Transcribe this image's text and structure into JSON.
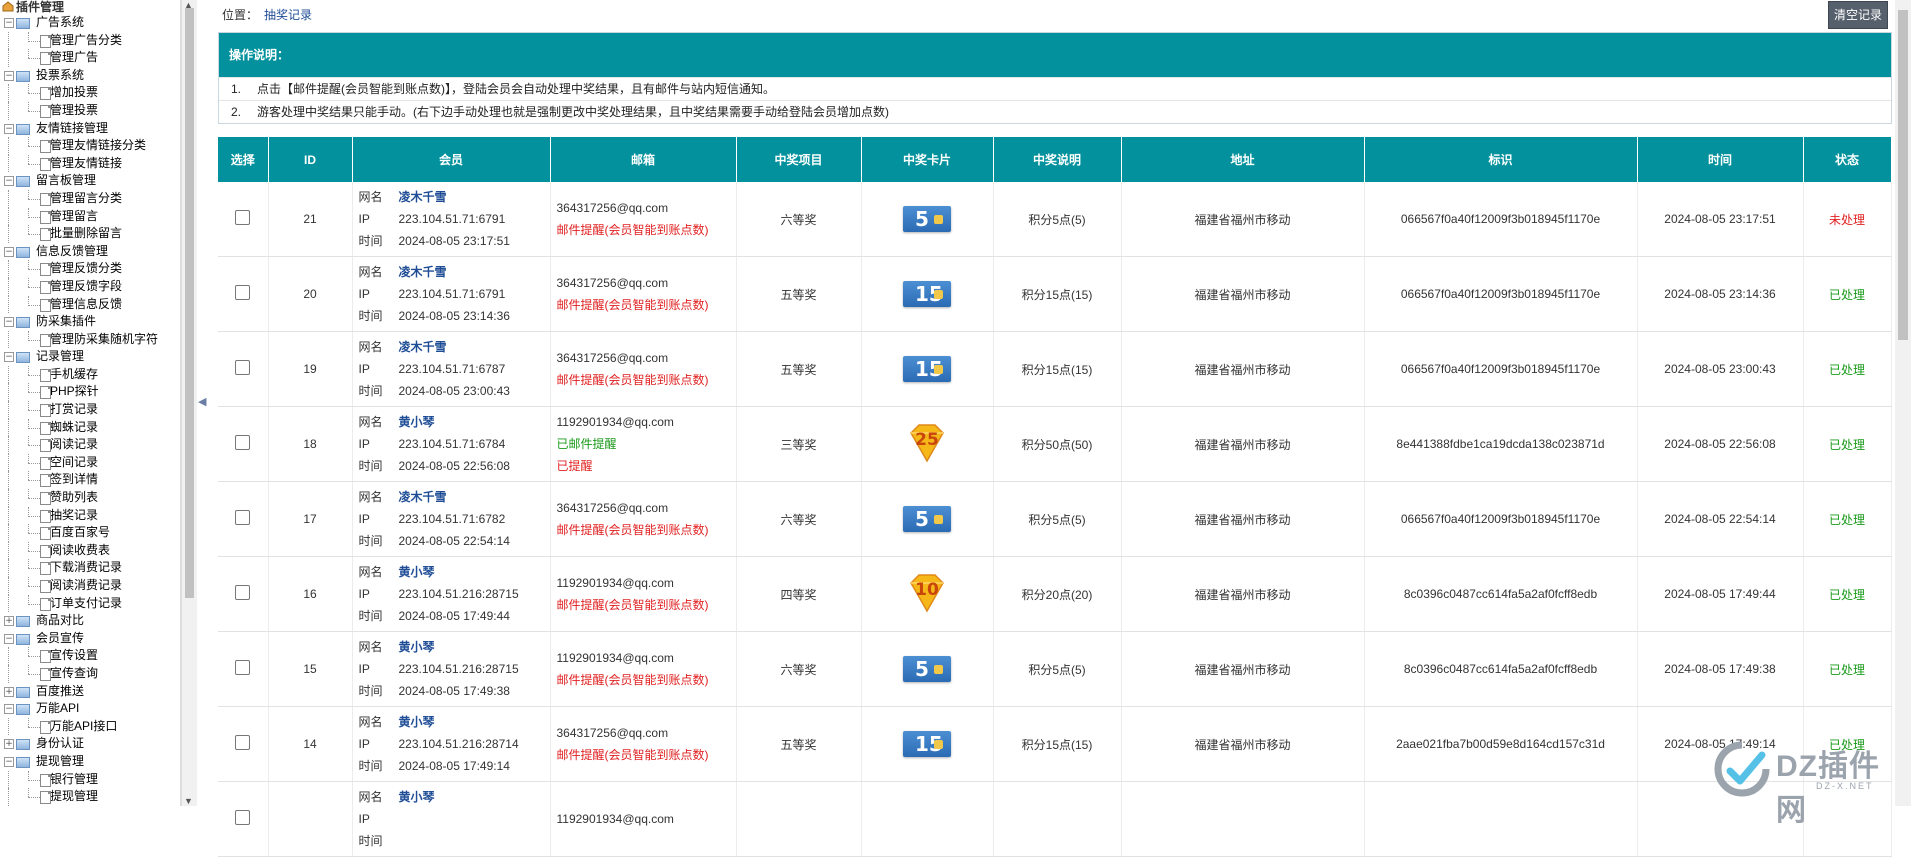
{
  "tree": {
    "root_label": "插件管理",
    "nodes": [
      {
        "kind": "cat",
        "label": "广告系统"
      },
      {
        "kind": "leaf",
        "label": "管理广告分类"
      },
      {
        "kind": "leaf",
        "label": "管理广告"
      },
      {
        "kind": "cat",
        "label": "投票系统"
      },
      {
        "kind": "leaf",
        "label": "增加投票"
      },
      {
        "kind": "leaf",
        "label": "管理投票"
      },
      {
        "kind": "cat",
        "label": "友情链接管理"
      },
      {
        "kind": "leaf",
        "label": "管理友情链接分类"
      },
      {
        "kind": "leaf",
        "label": "管理友情链接"
      },
      {
        "kind": "cat",
        "label": "留言板管理"
      },
      {
        "kind": "leaf",
        "label": "管理留言分类"
      },
      {
        "kind": "leaf",
        "label": "管理留言"
      },
      {
        "kind": "leaf",
        "label": "批量删除留言"
      },
      {
        "kind": "cat",
        "label": "信息反馈管理"
      },
      {
        "kind": "leaf",
        "label": "管理反馈分类"
      },
      {
        "kind": "leaf",
        "label": "管理反馈字段"
      },
      {
        "kind": "leaf",
        "label": "管理信息反馈"
      },
      {
        "kind": "cat",
        "label": "防采集插件"
      },
      {
        "kind": "leaf",
        "label": "管理防采集随机字符"
      },
      {
        "kind": "cat",
        "label": "记录管理"
      },
      {
        "kind": "leaf",
        "label": "手机缓存"
      },
      {
        "kind": "leaf",
        "label": "PHP探针"
      },
      {
        "kind": "leaf",
        "label": "打赏记录"
      },
      {
        "kind": "leaf",
        "label": "蜘蛛记录"
      },
      {
        "kind": "leaf",
        "label": "阅读记录"
      },
      {
        "kind": "leaf",
        "label": "空间记录"
      },
      {
        "kind": "leaf",
        "label": "签到详情"
      },
      {
        "kind": "leaf",
        "label": "赞助列表"
      },
      {
        "kind": "leaf",
        "label": "抽奖记录"
      },
      {
        "kind": "leaf",
        "label": "百度百家号"
      },
      {
        "kind": "leaf",
        "label": "阅读收费表"
      },
      {
        "kind": "leaf",
        "label": "下载消费记录"
      },
      {
        "kind": "leaf",
        "label": "阅读消费记录"
      },
      {
        "kind": "leaf",
        "label": "订单支付记录"
      },
      {
        "kind": "cat",
        "label": "商品对比",
        "collapsed": true
      },
      {
        "kind": "cat",
        "label": "会员宣传"
      },
      {
        "kind": "leaf",
        "label": "宣传设置"
      },
      {
        "kind": "leaf",
        "label": "宣传查询"
      },
      {
        "kind": "cat",
        "label": "百度推送",
        "collapsed": true
      },
      {
        "kind": "cat",
        "label": "万能API"
      },
      {
        "kind": "leaf",
        "label": "万能API接口"
      },
      {
        "kind": "cat",
        "label": "身份认证",
        "collapsed": true
      },
      {
        "kind": "cat",
        "label": "提现管理"
      },
      {
        "kind": "leaf",
        "label": "银行管理"
      },
      {
        "kind": "leaf",
        "label": "提现管理"
      }
    ]
  },
  "breadcrumb": {
    "prefix": "位置：",
    "current": "抽奖记录"
  },
  "clear_button": "清空记录",
  "notice": {
    "title": "操作说明：",
    "lines": [
      {
        "num": "1.",
        "text": "点击【邮件提醒(会员智能到账点数)】，登陆会员会自动处理中奖结果，且有邮件与站内短信通知。"
      },
      {
        "num": "2.",
        "text": "游客处理中奖结果只能手动。(右下边手动处理也就是强制更改中奖处理结果，且中奖结果需要手动给登陆会员增加点数)"
      }
    ]
  },
  "table": {
    "headers": [
      "选择",
      "ID",
      "会员",
      "邮箱",
      "中奖项目",
      "中奖卡片",
      "中奖说明",
      "地址",
      "标识",
      "时间",
      "状态"
    ],
    "member_keys": {
      "name": "网名",
      "ip": "IP",
      "time": "时间"
    },
    "rows": [
      {
        "id": "21",
        "name": "凌木千雪",
        "ip": "223.104.51.71:6791",
        "time": "2024-08-05 23:17:51",
        "email": "364317256@qq.com",
        "email_lines": [
          {
            "text": "邮件提醒(会员智能到账点数)",
            "color": "red"
          }
        ],
        "prize": "六等奖",
        "card": "5",
        "card_style": "blue",
        "desc": "积分5点(5)",
        "addr": "福建省福州市移动",
        "tag": "066567f0a40f12009f3b018945f1170e",
        "datetime": "2024-08-05 23:17:51",
        "status": "未处理",
        "status_color": "red"
      },
      {
        "id": "20",
        "name": "凌木千雪",
        "ip": "223.104.51.71:6791",
        "time": "2024-08-05 23:14:36",
        "email": "364317256@qq.com",
        "email_lines": [
          {
            "text": "邮件提醒(会员智能到账点数)",
            "color": "red"
          }
        ],
        "prize": "五等奖",
        "card": "15",
        "card_style": "blue",
        "desc": "积分15点(15)",
        "addr": "福建省福州市移动",
        "tag": "066567f0a40f12009f3b018945f1170e",
        "datetime": "2024-08-05 23:14:36",
        "status": "已处理",
        "status_color": "green"
      },
      {
        "id": "19",
        "name": "凌木千雪",
        "ip": "223.104.51.71:6787",
        "time": "2024-08-05 23:00:43",
        "email": "364317256@qq.com",
        "email_lines": [
          {
            "text": "邮件提醒(会员智能到账点数)",
            "color": "red"
          }
        ],
        "prize": "五等奖",
        "card": "15",
        "card_style": "blue",
        "desc": "积分15点(15)",
        "addr": "福建省福州市移动",
        "tag": "066567f0a40f12009f3b018945f1170e",
        "datetime": "2024-08-05 23:00:43",
        "status": "已处理",
        "status_color": "green"
      },
      {
        "id": "18",
        "name": "黄小琴",
        "ip": "223.104.51.71:6784",
        "time": "2024-08-05 22:56:08",
        "email": "1192901934@qq.com",
        "email_lines": [
          {
            "text": "已邮件提醒",
            "color": "green"
          },
          {
            "text": "已提醒",
            "color": "red"
          }
        ],
        "prize": "三等奖",
        "card": "25",
        "card_style": "gem",
        "desc": "积分50点(50)",
        "addr": "福建省福州市移动",
        "tag": "8e441388fdbe1ca19dcda138c023871d",
        "datetime": "2024-08-05 22:56:08",
        "status": "已处理",
        "status_color": "green"
      },
      {
        "id": "17",
        "name": "凌木千雪",
        "ip": "223.104.51.71:6782",
        "time": "2024-08-05 22:54:14",
        "email": "364317256@qq.com",
        "email_lines": [
          {
            "text": "邮件提醒(会员智能到账点数)",
            "color": "red"
          }
        ],
        "prize": "六等奖",
        "card": "5",
        "card_style": "blue",
        "desc": "积分5点(5)",
        "addr": "福建省福州市移动",
        "tag": "066567f0a40f12009f3b018945f1170e",
        "datetime": "2024-08-05 22:54:14",
        "status": "已处理",
        "status_color": "green"
      },
      {
        "id": "16",
        "name": "黄小琴",
        "ip": "223.104.51.216:28715",
        "time": "2024-08-05 17:49:44",
        "email": "1192901934@qq.com",
        "email_lines": [
          {
            "text": "邮件提醒(会员智能到账点数)",
            "color": "red"
          }
        ],
        "prize": "四等奖",
        "card": "10",
        "card_style": "gem",
        "desc": "积分20点(20)",
        "addr": "福建省福州市移动",
        "tag": "8c0396c0487cc614fa5a2af0fcff8edb",
        "datetime": "2024-08-05 17:49:44",
        "status": "已处理",
        "status_color": "green"
      },
      {
        "id": "15",
        "name": "黄小琴",
        "ip": "223.104.51.216:28715",
        "time": "2024-08-05 17:49:38",
        "email": "1192901934@qq.com",
        "email_lines": [
          {
            "text": "邮件提醒(会员智能到账点数)",
            "color": "red"
          }
        ],
        "prize": "六等奖",
        "card": "5",
        "card_style": "blue",
        "desc": "积分5点(5)",
        "addr": "福建省福州市移动",
        "tag": "8c0396c0487cc614fa5a2af0fcff8edb",
        "datetime": "2024-08-05 17:49:38",
        "status": "已处理",
        "status_color": "green"
      },
      {
        "id": "14",
        "name": "黄小琴",
        "ip": "223.104.51.216:28714",
        "time": "2024-08-05 17:49:14",
        "email": "364317256@qq.com",
        "email_lines": [
          {
            "text": "邮件提醒(会员智能到账点数)",
            "color": "red"
          }
        ],
        "prize": "五等奖",
        "card": "15",
        "card_style": "blue",
        "desc": "积分15点(15)",
        "addr": "福建省福州市移动",
        "tag": "2aae021fba7b00d59e8d164cd157c31d",
        "datetime": "2024-08-05 17:49:14",
        "status": "已处理",
        "status_color": "green"
      },
      {
        "id": "",
        "name": "黄小琴",
        "ip": "",
        "time": "",
        "email": "1192901934@qq.com",
        "email_lines": [],
        "prize": "",
        "card": "",
        "card_style": "none",
        "desc": "",
        "addr": "",
        "tag": "",
        "datetime": "",
        "status": "",
        "status_color": "green"
      }
    ]
  },
  "watermark": {
    "text": "DZ插件网",
    "sub": "DZ-X.NET"
  },
  "colors": {
    "header_teal": "#03929d",
    "link_blue": "#1f4d96",
    "status_red": "#e02020",
    "status_green": "#1a9a1a",
    "button_gray": "#56606c"
  }
}
